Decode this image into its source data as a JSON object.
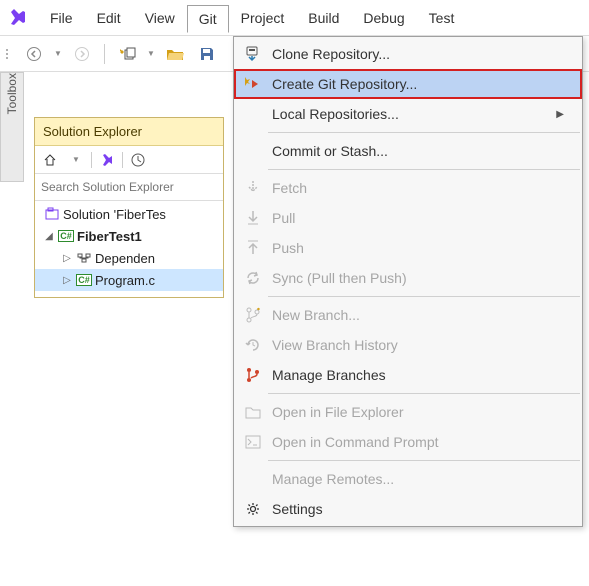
{
  "menu": {
    "file": "File",
    "edit": "Edit",
    "view": "View",
    "git": "Git",
    "project": "Project",
    "build": "Build",
    "debug": "Debug",
    "test": "Test"
  },
  "sidestrip": {
    "label": "Toolbox"
  },
  "panel": {
    "title": "Solution Explorer",
    "search_placeholder": "Search Solution Explorer",
    "tree": {
      "solution": "Solution 'FiberTes",
      "project": "FiberTest1",
      "dependencies": "Dependen",
      "program": "Program.c"
    }
  },
  "git_menu": {
    "clone": "Clone Repository...",
    "create": "Create Git Repository...",
    "local": "Local Repositories...",
    "commit": "Commit or Stash...",
    "fetch": "Fetch",
    "pull": "Pull",
    "push": "Push",
    "sync": "Sync (Pull then Push)",
    "new_branch": "New Branch...",
    "history": "View Branch History",
    "manage_branches": "Manage Branches",
    "explorer": "Open in File Explorer",
    "cmd": "Open in Command Prompt",
    "remotes": "Manage Remotes...",
    "settings": "Settings"
  }
}
